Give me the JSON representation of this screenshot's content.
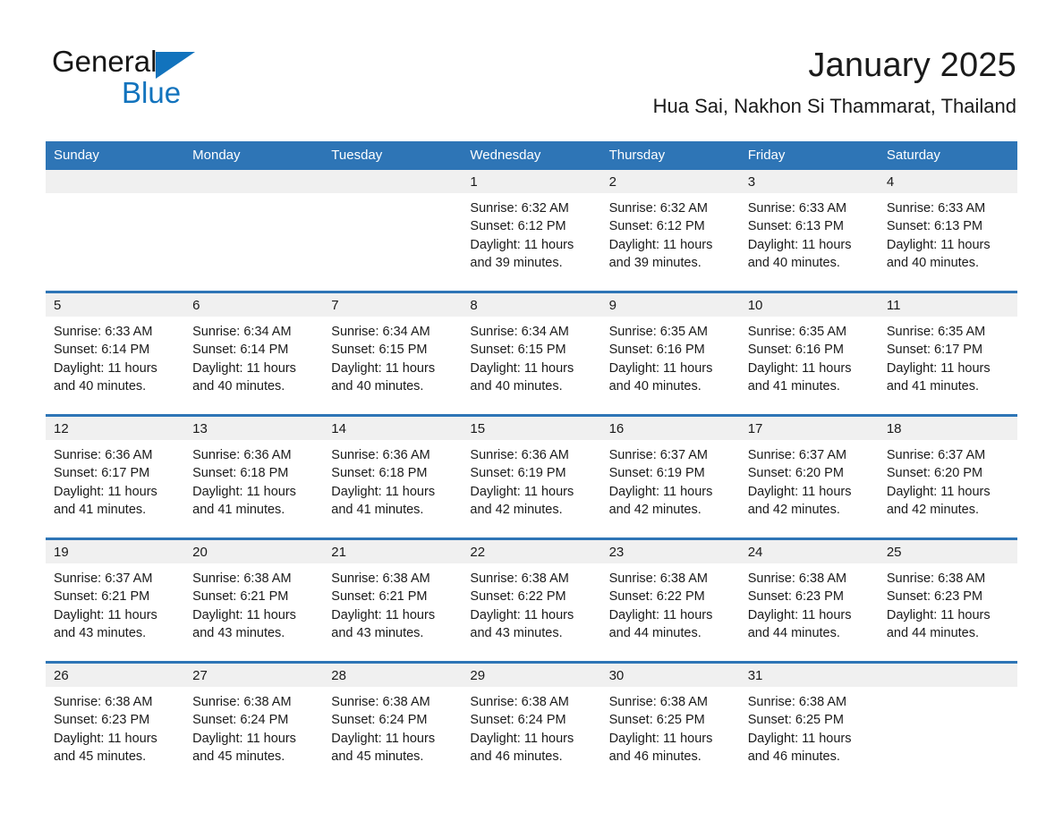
{
  "brand": {
    "name_part1": "General",
    "name_part2": "Blue",
    "triangle_color": "#1273bd",
    "logo_icon": "general-blue-logo-triangle-icon"
  },
  "header": {
    "title": "January 2025",
    "location": "Hua Sai, Nakhon Si Thammarat, Thailand"
  },
  "colors": {
    "header_blue": "#2e75b6",
    "row_divider_blue": "#2e75b6",
    "daynum_band_gray": "#f0f0f0",
    "text": "#1a1a1a"
  },
  "calendar": {
    "weekday_headers": [
      "Sunday",
      "Monday",
      "Tuesday",
      "Wednesday",
      "Thursday",
      "Friday",
      "Saturday"
    ],
    "weeks": [
      [
        {
          "day": "",
          "sunrise": "",
          "sunset": "",
          "daylight": ""
        },
        {
          "day": "",
          "sunrise": "",
          "sunset": "",
          "daylight": ""
        },
        {
          "day": "",
          "sunrise": "",
          "sunset": "",
          "daylight": ""
        },
        {
          "day": "1",
          "sunrise": "Sunrise: 6:32 AM",
          "sunset": "Sunset: 6:12 PM",
          "daylight": "Daylight: 11 hours and 39 minutes."
        },
        {
          "day": "2",
          "sunrise": "Sunrise: 6:32 AM",
          "sunset": "Sunset: 6:12 PM",
          "daylight": "Daylight: 11 hours and 39 minutes."
        },
        {
          "day": "3",
          "sunrise": "Sunrise: 6:33 AM",
          "sunset": "Sunset: 6:13 PM",
          "daylight": "Daylight: 11 hours and 40 minutes."
        },
        {
          "day": "4",
          "sunrise": "Sunrise: 6:33 AM",
          "sunset": "Sunset: 6:13 PM",
          "daylight": "Daylight: 11 hours and 40 minutes."
        }
      ],
      [
        {
          "day": "5",
          "sunrise": "Sunrise: 6:33 AM",
          "sunset": "Sunset: 6:14 PM",
          "daylight": "Daylight: 11 hours and 40 minutes."
        },
        {
          "day": "6",
          "sunrise": "Sunrise: 6:34 AM",
          "sunset": "Sunset: 6:14 PM",
          "daylight": "Daylight: 11 hours and 40 minutes."
        },
        {
          "day": "7",
          "sunrise": "Sunrise: 6:34 AM",
          "sunset": "Sunset: 6:15 PM",
          "daylight": "Daylight: 11 hours and 40 minutes."
        },
        {
          "day": "8",
          "sunrise": "Sunrise: 6:34 AM",
          "sunset": "Sunset: 6:15 PM",
          "daylight": "Daylight: 11 hours and 40 minutes."
        },
        {
          "day": "9",
          "sunrise": "Sunrise: 6:35 AM",
          "sunset": "Sunset: 6:16 PM",
          "daylight": "Daylight: 11 hours and 40 minutes."
        },
        {
          "day": "10",
          "sunrise": "Sunrise: 6:35 AM",
          "sunset": "Sunset: 6:16 PM",
          "daylight": "Daylight: 11 hours and 41 minutes."
        },
        {
          "day": "11",
          "sunrise": "Sunrise: 6:35 AM",
          "sunset": "Sunset: 6:17 PM",
          "daylight": "Daylight: 11 hours and 41 minutes."
        }
      ],
      [
        {
          "day": "12",
          "sunrise": "Sunrise: 6:36 AM",
          "sunset": "Sunset: 6:17 PM",
          "daylight": "Daylight: 11 hours and 41 minutes."
        },
        {
          "day": "13",
          "sunrise": "Sunrise: 6:36 AM",
          "sunset": "Sunset: 6:18 PM",
          "daylight": "Daylight: 11 hours and 41 minutes."
        },
        {
          "day": "14",
          "sunrise": "Sunrise: 6:36 AM",
          "sunset": "Sunset: 6:18 PM",
          "daylight": "Daylight: 11 hours and 41 minutes."
        },
        {
          "day": "15",
          "sunrise": "Sunrise: 6:36 AM",
          "sunset": "Sunset: 6:19 PM",
          "daylight": "Daylight: 11 hours and 42 minutes."
        },
        {
          "day": "16",
          "sunrise": "Sunrise: 6:37 AM",
          "sunset": "Sunset: 6:19 PM",
          "daylight": "Daylight: 11 hours and 42 minutes."
        },
        {
          "day": "17",
          "sunrise": "Sunrise: 6:37 AM",
          "sunset": "Sunset: 6:20 PM",
          "daylight": "Daylight: 11 hours and 42 minutes."
        },
        {
          "day": "18",
          "sunrise": "Sunrise: 6:37 AM",
          "sunset": "Sunset: 6:20 PM",
          "daylight": "Daylight: 11 hours and 42 minutes."
        }
      ],
      [
        {
          "day": "19",
          "sunrise": "Sunrise: 6:37 AM",
          "sunset": "Sunset: 6:21 PM",
          "daylight": "Daylight: 11 hours and 43 minutes."
        },
        {
          "day": "20",
          "sunrise": "Sunrise: 6:38 AM",
          "sunset": "Sunset: 6:21 PM",
          "daylight": "Daylight: 11 hours and 43 minutes."
        },
        {
          "day": "21",
          "sunrise": "Sunrise: 6:38 AM",
          "sunset": "Sunset: 6:21 PM",
          "daylight": "Daylight: 11 hours and 43 minutes."
        },
        {
          "day": "22",
          "sunrise": "Sunrise: 6:38 AM",
          "sunset": "Sunset: 6:22 PM",
          "daylight": "Daylight: 11 hours and 43 minutes."
        },
        {
          "day": "23",
          "sunrise": "Sunrise: 6:38 AM",
          "sunset": "Sunset: 6:22 PM",
          "daylight": "Daylight: 11 hours and 44 minutes."
        },
        {
          "day": "24",
          "sunrise": "Sunrise: 6:38 AM",
          "sunset": "Sunset: 6:23 PM",
          "daylight": "Daylight: 11 hours and 44 minutes."
        },
        {
          "day": "25",
          "sunrise": "Sunrise: 6:38 AM",
          "sunset": "Sunset: 6:23 PM",
          "daylight": "Daylight: 11 hours and 44 minutes."
        }
      ],
      [
        {
          "day": "26",
          "sunrise": "Sunrise: 6:38 AM",
          "sunset": "Sunset: 6:23 PM",
          "daylight": "Daylight: 11 hours and 45 minutes."
        },
        {
          "day": "27",
          "sunrise": "Sunrise: 6:38 AM",
          "sunset": "Sunset: 6:24 PM",
          "daylight": "Daylight: 11 hours and 45 minutes."
        },
        {
          "day": "28",
          "sunrise": "Sunrise: 6:38 AM",
          "sunset": "Sunset: 6:24 PM",
          "daylight": "Daylight: 11 hours and 45 minutes."
        },
        {
          "day": "29",
          "sunrise": "Sunrise: 6:38 AM",
          "sunset": "Sunset: 6:24 PM",
          "daylight": "Daylight: 11 hours and 46 minutes."
        },
        {
          "day": "30",
          "sunrise": "Sunrise: 6:38 AM",
          "sunset": "Sunset: 6:25 PM",
          "daylight": "Daylight: 11 hours and 46 minutes."
        },
        {
          "day": "31",
          "sunrise": "Sunrise: 6:38 AM",
          "sunset": "Sunset: 6:25 PM",
          "daylight": "Daylight: 11 hours and 46 minutes."
        },
        {
          "day": "",
          "sunrise": "",
          "sunset": "",
          "daylight": ""
        }
      ]
    ]
  }
}
